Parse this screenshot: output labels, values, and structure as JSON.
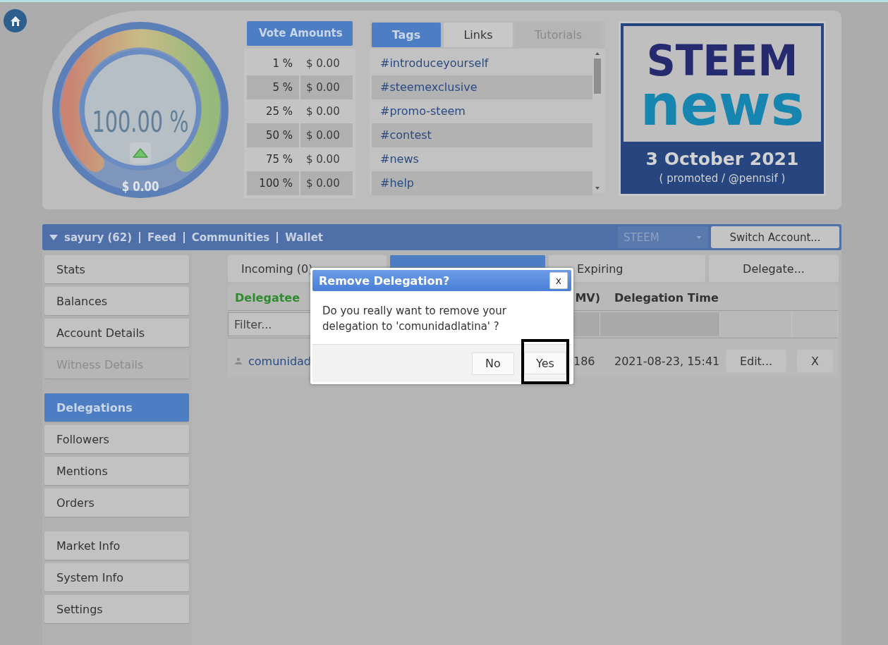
{
  "gauge": {
    "percent": "100.00 %",
    "value": "$ 0.00"
  },
  "vote_amounts": {
    "title": "Vote Amounts",
    "rows": [
      {
        "percent": "1 %",
        "value": "$ 0.00"
      },
      {
        "percent": "5 %",
        "value": "$ 0.00"
      },
      {
        "percent": "25 %",
        "value": "$ 0.00"
      },
      {
        "percent": "50 %",
        "value": "$ 0.00"
      },
      {
        "percent": "75 %",
        "value": "$ 0.00"
      },
      {
        "percent": "100 %",
        "value": "$ 0.00"
      }
    ]
  },
  "tabs": [
    {
      "label": "Tags",
      "selected": true,
      "disabled": false
    },
    {
      "label": "Links",
      "selected": false,
      "disabled": false
    },
    {
      "label": "Tutorials",
      "selected": false,
      "disabled": true
    }
  ],
  "tags": [
    "#introduceyourself",
    "#steemexclusive",
    "#promo-steem",
    "#contest",
    "#news",
    "#help"
  ],
  "news": {
    "logo_top": "STEEM",
    "logo_bottom": "news",
    "date": "3 October 2021",
    "credit": "( promoted / @pennsif )"
  },
  "account_bar": {
    "links": [
      "sayury (62)",
      "Feed",
      "Communities",
      "Wallet"
    ],
    "currency": "STEEM",
    "switch_button": "Switch Account..."
  },
  "sidebar": {
    "groups": [
      [
        {
          "label": "Stats",
          "selected": false,
          "disabled": false
        },
        {
          "label": "Balances",
          "selected": false,
          "disabled": false
        },
        {
          "label": "Account Details",
          "selected": false,
          "disabled": false
        },
        {
          "label": "Witness Details",
          "selected": false,
          "disabled": true
        }
      ],
      [
        {
          "label": "Delegations",
          "selected": true,
          "disabled": false
        },
        {
          "label": "Followers",
          "selected": false,
          "disabled": false
        },
        {
          "label": "Mentions",
          "selected": false,
          "disabled": false
        },
        {
          "label": "Orders",
          "selected": false,
          "disabled": false
        }
      ],
      [
        {
          "label": "Market Info",
          "selected": false,
          "disabled": false
        },
        {
          "label": "System Info",
          "selected": false,
          "disabled": false
        },
        {
          "label": "Settings",
          "selected": false,
          "disabled": false
        }
      ]
    ]
  },
  "delegation_tabs": [
    {
      "label": "Incoming (0)",
      "selected": false
    },
    {
      "selected": true
    },
    {
      "label": "Expiring",
      "selected": false
    }
  ],
  "delegate_button": "Delegate...",
  "table": {
    "headers": {
      "delegatee": "Delegatee",
      "column_3": "MV)",
      "delegation_time": "Delegation Time"
    },
    "filter_placeholder": "Filter...",
    "rows": [
      {
        "delegatee": "comunidad",
        "column_3": "186",
        "delegation_time": "2021-08-23, 15:41",
        "edit": "Edit...",
        "remove": "X"
      }
    ]
  },
  "dialog": {
    "title": "Remove Delegation?",
    "close": "x",
    "message": "Do you really want to remove your delegation to 'comunidadlatina' ?",
    "buttons": [
      {
        "label": "No",
        "highlighted": false
      },
      {
        "label": "Yes",
        "highlighted": true
      }
    ]
  }
}
